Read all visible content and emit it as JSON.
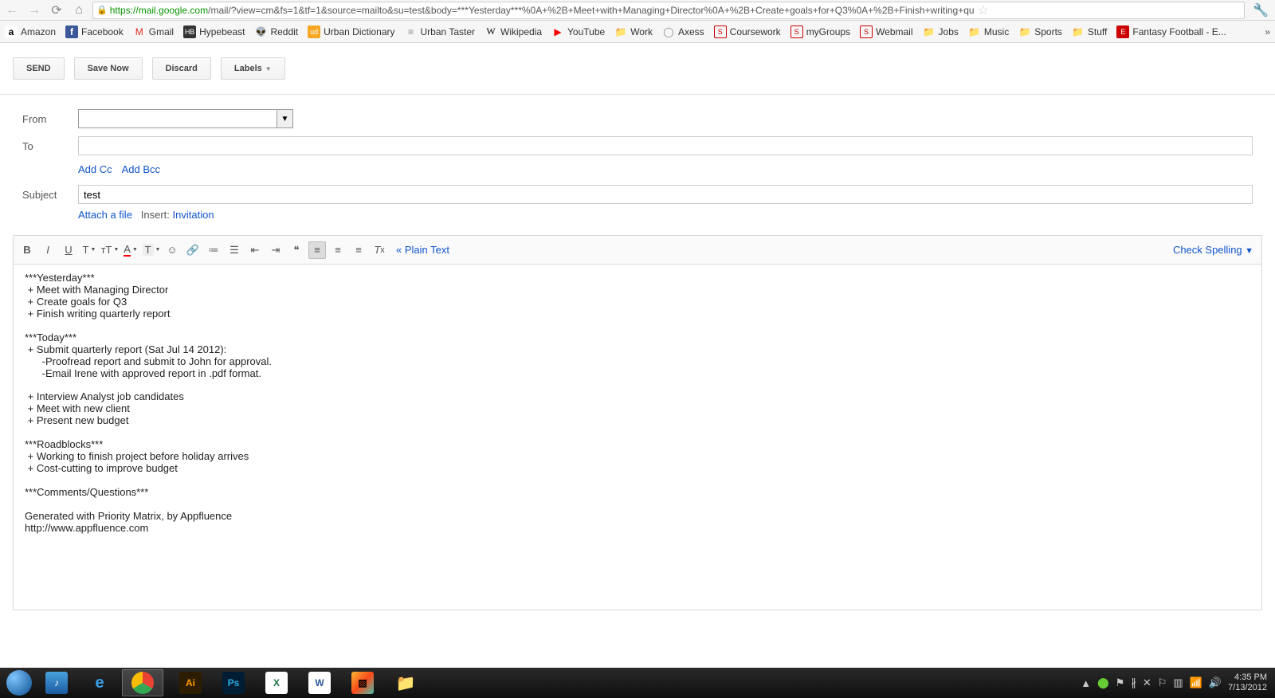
{
  "url": {
    "host": "https://mail.google.com",
    "path": "/mail/?view=cm&fs=1&tf=1&source=mailto&su=test&body=***Yesterday***%0A+%2B+Meet+with+Managing+Director%0A+%2B+Create+goals+for+Q3%0A+%2B+Finish+writing+qu"
  },
  "bookmarks": [
    "Amazon",
    "Facebook",
    "Gmail",
    "Hypebeast",
    "Reddit",
    "Urban Dictionary",
    "Urban Taster",
    "Wikipedia",
    "YouTube",
    "Work",
    "Axess",
    "Coursework",
    "myGroups",
    "Webmail",
    "Jobs",
    "Music",
    "Sports",
    "Stuff",
    "Fantasy Football - E..."
  ],
  "buttons": {
    "send": "SEND",
    "save": "Save Now",
    "discard": "Discard",
    "labels": "Labels"
  },
  "fields": {
    "from": "From",
    "to": "To",
    "subject": "Subject",
    "subject_value": "test"
  },
  "links": {
    "cc": "Add Cc",
    "bcc": "Add Bcc",
    "attach": "Attach a file",
    "insert": "Insert:",
    "invitation": "Invitation",
    "plain": "« Plain Text",
    "spell": "Check Spelling"
  },
  "body": "***Yesterday***\n + Meet with Managing Director\n + Create goals for Q3\n + Finish writing quarterly report\n\n***Today***\n + Submit quarterly report (Sat Jul 14 2012):\n      -Proofread report and submit to John for approval.\n      -Email Irene with approved report in .pdf format.\n\n + Interview Analyst job candidates\n + Meet with new client\n + Present new budget\n\n***Roadblocks***\n + Working to finish project before holiday arrives\n + Cost-cutting to improve budget\n\n***Comments/Questions***\n\nGenerated with Priority Matrix, by Appfluence\nhttp://www.appfluence.com",
  "clock": {
    "time": "4:35 PM",
    "date": "7/13/2012"
  }
}
